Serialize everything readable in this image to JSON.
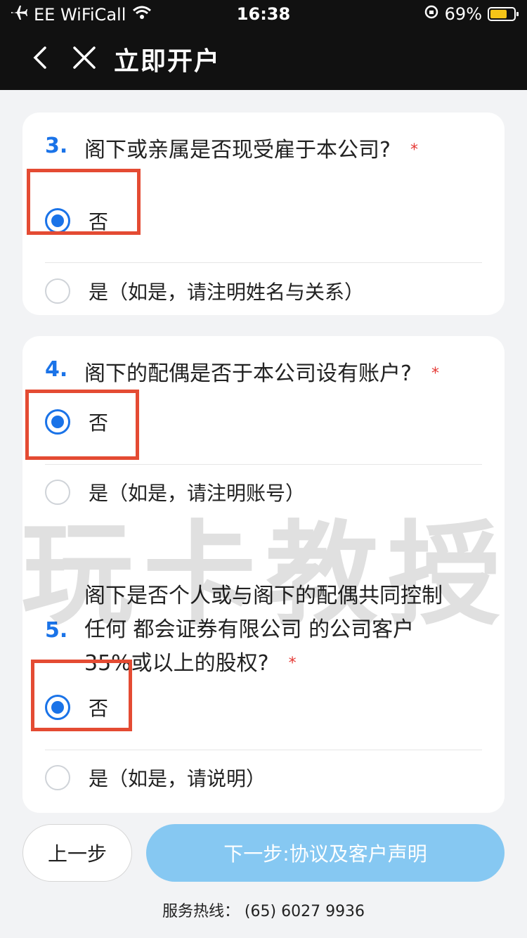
{
  "status_bar": {
    "carrier": "EE WiFiCall",
    "time": "16:38",
    "battery": "69%",
    "battery_level": 0.69
  },
  "nav": {
    "title": "立即开户",
    "back_icon": "chevron-left-icon",
    "close_icon": "close-icon"
  },
  "questions": [
    {
      "number": "3.",
      "text": "阁下或亲属是否现受雇于本公司?",
      "required": "*",
      "options": [
        {
          "label": "否",
          "checked": true
        },
        {
          "label": "是（如是，请注明姓名与关系）",
          "checked": false
        }
      ]
    },
    {
      "number": "4.",
      "text": "阁下的配偶是否于本公司设有账户?",
      "required": "*",
      "options": [
        {
          "label": "否",
          "checked": true
        },
        {
          "label": "是（如是，请注明账号）",
          "checked": false
        }
      ]
    },
    {
      "number": "5.",
      "text_lines": [
        "阁下是否个人或与阁下的配偶共同控制",
        "任何 都会证券有限公司 的公司客户",
        "35%或以上的股权?"
      ],
      "required": "*",
      "options": [
        {
          "label": "否",
          "checked": true
        },
        {
          "label": "是（如是，请说明）",
          "checked": false
        }
      ]
    }
  ],
  "watermark": "玩卡教授",
  "footer": {
    "prev_label": "上一步",
    "next_label": "下一步:协议及客户声明",
    "hotline": "服务热线： (65) 6027 9936"
  },
  "colors": {
    "accent": "#1a73e8",
    "required": "#e53935",
    "highlight_box": "#e44b33",
    "next_button": "#86c8f2"
  }
}
